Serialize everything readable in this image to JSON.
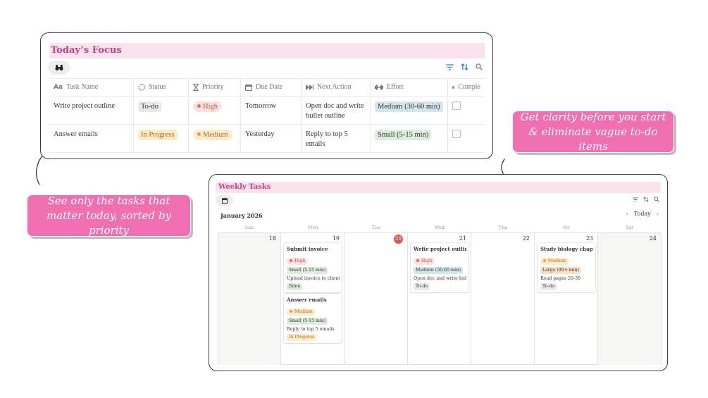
{
  "focus": {
    "title": "Today’s Focus",
    "view_icon": "binoculars-icon",
    "columns": [
      {
        "label": "Task Name",
        "icon": "text-aa-icon"
      },
      {
        "label": "Status",
        "icon": "status-circle-icon"
      },
      {
        "label": "Priority",
        "icon": "hourglass-icon"
      },
      {
        "label": "Due Date",
        "icon": "calendar-icon"
      },
      {
        "label": "Next Action",
        "icon": "fast-forward-icon"
      },
      {
        "label": "Effort",
        "icon": "dumbbell-icon"
      },
      {
        "label": "Comple",
        "icon": "checkbox-icon"
      }
    ],
    "rows": [
      {
        "task": "Write project outline",
        "status": "To-do",
        "priority": "High",
        "due": "Tomorrow",
        "next": "Open doc and write bullet outline",
        "effort": "Medium (30-60 min)",
        "complete": false
      },
      {
        "task": "Answer emails",
        "status": "In Progress",
        "priority": "Medium",
        "due": "Yesterday",
        "next": "Reply to top 5 emails",
        "effort": "Small (5-15 min)",
        "complete": false
      }
    ]
  },
  "callouts": {
    "left": "See only the tasks that matter today, sorted by priority",
    "right": "Get clarity before you start & eliminate vague to-do items"
  },
  "weekly": {
    "title": "Weekly Tasks",
    "view_icon": "calendar-icon",
    "month": "January 2026",
    "today_label": "Today",
    "weekdays": [
      "Sun",
      "Mon",
      "Tue",
      "Wed",
      "Thu",
      "Fri",
      "Sat"
    ],
    "days": [
      "18",
      "19",
      "20",
      "21",
      "22",
      "23",
      "24"
    ],
    "today_index": 2,
    "events": [
      {
        "title": "Submit invoice",
        "priority": "High",
        "effort": "Small (5-15 min)",
        "next": "Upload invoice to client porta",
        "status": "Done"
      },
      {
        "title": "Answer emails",
        "priority": "Medium",
        "effort": "Small (5-15 min)",
        "next": "Reply to top 5 emails",
        "status": "In Progress"
      },
      {
        "title": "Write project outline",
        "priority": "High",
        "effort": "Medium (30-60 min)",
        "next": "Open doc and write bullet out",
        "status": "To-do"
      },
      {
        "title": "Study biology chapter",
        "priority": "Medium",
        "effort": "Large (90+ min)",
        "next": "Read pages 20-30",
        "status": "To-do"
      }
    ]
  },
  "colors": {
    "title_text": "#c93c86",
    "title_bg": "#fbe3ee",
    "callout_bg": "#f06fb1",
    "todo_bg": "#e9e9e7",
    "inprogress_bg": "#fbecc8",
    "inprogress_text": "#b3661a",
    "done_bg": "#dbeddb",
    "high_bg": "#ffe2dd",
    "high_text": "#c4554d",
    "high_dot": "#e16a5f",
    "medium_bg": "#fdecc8",
    "medium_text": "#b56a2b",
    "medium_dot": "#e59a5e",
    "effort_medium_bg": "#d3e5ef",
    "effort_small_bg": "#dbeddb",
    "effort_large_bg": "#fadec9",
    "today_dot": "#e0544e"
  }
}
